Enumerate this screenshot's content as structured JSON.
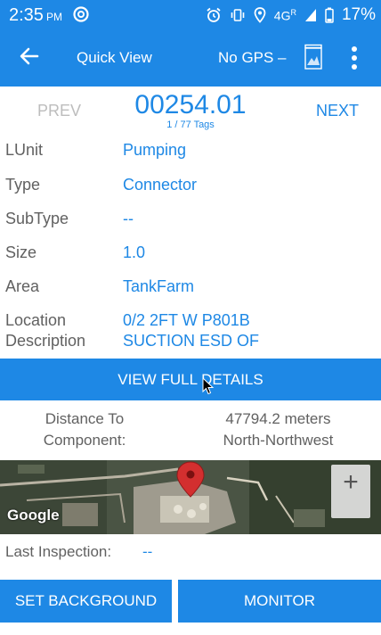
{
  "status_bar": {
    "time": "2:35",
    "ampm": "PM",
    "network": "4G",
    "network_sup": "R",
    "battery": "17%"
  },
  "app_bar": {
    "title": "Quick View",
    "gps_status": "No GPS",
    "gps_dash": "–"
  },
  "tag_nav": {
    "prev_label": "PREV",
    "next_label": "NEXT",
    "tag_id": "00254.01",
    "tag_count": "1 / 77 Tags"
  },
  "fields": {
    "lunit": {
      "label": "LUnit",
      "value": "Pumping"
    },
    "type": {
      "label": "Type",
      "value": "Connector"
    },
    "subtype": {
      "label": "SubType",
      "value": "--"
    },
    "size": {
      "label": "Size",
      "value": "1.0"
    },
    "area": {
      "label": "Area",
      "value": "TankFarm"
    },
    "location": {
      "label_line1": "Location",
      "label_line2": "Description",
      "value_line1": "0/2 2FT W P801B",
      "value_line2": "SUCTION ESD OF"
    }
  },
  "actions": {
    "view_full_details": "VIEW FULL DETAILS",
    "set_background": "SET BACKGROUND",
    "monitor": "MONITOR"
  },
  "distance": {
    "label_line1": "Distance To",
    "label_line2": "Component:",
    "value_line1": "47794.2 meters",
    "value_line2": "North-Northwest"
  },
  "map": {
    "attribution": "Google",
    "zoom_in": "+"
  },
  "last_inspection": {
    "label": "Last Inspection:",
    "value": "--"
  },
  "colors": {
    "primary": "#1e88e5",
    "label_gray": "#616161",
    "disabled_gray": "#bdbdbd",
    "marker_red": "#d32f2f"
  }
}
